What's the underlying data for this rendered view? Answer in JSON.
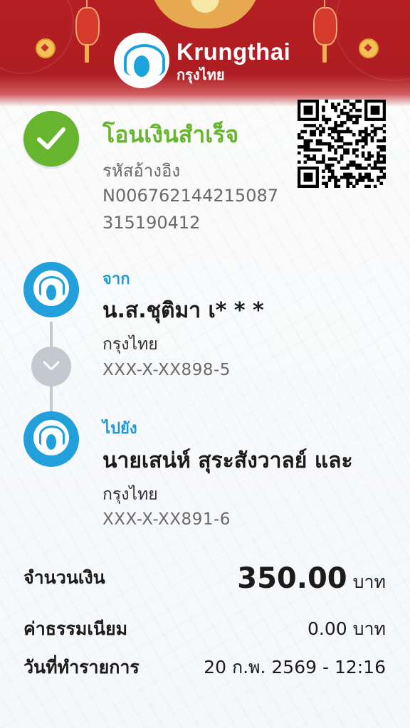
{
  "brand": {
    "name_en": "Krungthai",
    "name_th": "กรุงไทย"
  },
  "status": {
    "title": "โอนเงินสำเร็จ",
    "ref_label": "รหัสอ้างอิง",
    "ref_number": "N006762144215087315190412"
  },
  "from": {
    "label": "จาก",
    "name": "น.ส.ชุติมา เ* * *",
    "bank": "กรุงไทย",
    "account": "XXX-X-XX898-5"
  },
  "to": {
    "label": "ไปยัง",
    "name": "นายเสน่ห์ สุระสังวาลย์ และ",
    "bank": "กรุงไทย",
    "account": "XXX-X-XX891-6"
  },
  "summary": {
    "amount_label": "จำนวนเงิน",
    "amount_value": "350.00",
    "amount_unit": "บาท",
    "fee_label": "ค่าธรรมเนียม",
    "fee_value": "0.00 บาท",
    "date_label": "วันที่ทำรายการ",
    "date_value": "20 ก.พ. 2569 - 12:16"
  },
  "colors": {
    "header_red": "#b51f25",
    "success_green": "#67b52e",
    "brand_blue": "#1c9ad6"
  },
  "icons": {
    "status": "checkmark-icon",
    "qr": "qr-code-icon",
    "bank_logo": "krungthai-logo-icon",
    "flow": "chevron-down-icon"
  }
}
